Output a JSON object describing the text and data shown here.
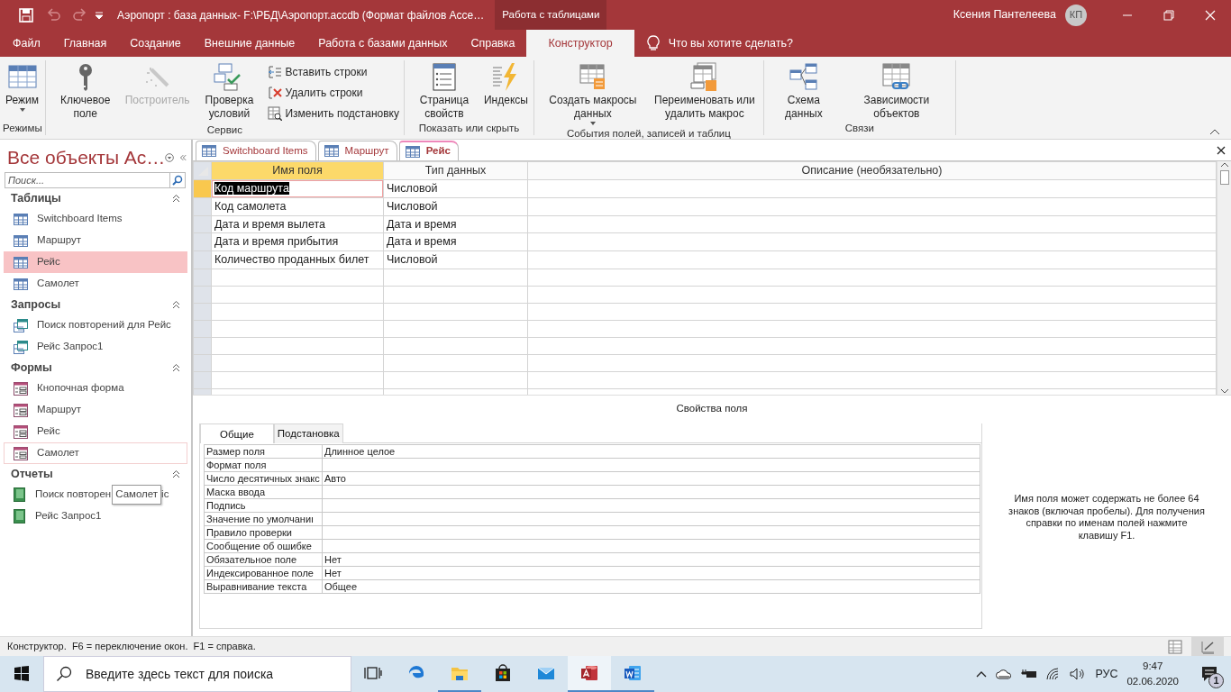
{
  "window": {
    "title": "Аэропорт : база данных- F:\\РБД\\Аэропорт.accdb (Формат файлов Acce…",
    "context_tab": "Работа с таблицами",
    "user": "Ксения Пантелеева",
    "avatar": "КП"
  },
  "quick_access": [
    {
      "disabled": false
    },
    {
      "disabled": true
    },
    {
      "disabled": true
    }
  ],
  "ribbon_tabs": [
    {
      "label": "Файл",
      "selected": false
    },
    {
      "label": "Главная",
      "selected": false
    },
    {
      "label": "Создание",
      "selected": false
    },
    {
      "label": "Внешние данные",
      "selected": false
    },
    {
      "label": "Работа с базами данных",
      "selected": false
    },
    {
      "label": "Справка",
      "selected": false
    },
    {
      "label": "Конструктор",
      "selected": true
    }
  ],
  "tell_me": "Что вы хотите сделать?",
  "ribbon_groups": [
    {
      "label": "Режимы",
      "buttons": [
        {
          "kind": "large",
          "label": "Режим",
          "dropdown": true,
          "disabled": false
        }
      ]
    },
    {
      "label": "Сервис",
      "buttons": [
        {
          "kind": "large",
          "label": "Ключевое поле",
          "dropdown": false,
          "disabled": false
        },
        {
          "kind": "large",
          "label": "Построитель",
          "dropdown": false,
          "disabled": true
        },
        {
          "kind": "large",
          "label": "Проверка условий",
          "dropdown": false,
          "disabled": false
        },
        {
          "kind": "small",
          "label": "Вставить строки",
          "disabled": false
        },
        {
          "kind": "small",
          "label": "Удалить строки",
          "disabled": false
        },
        {
          "kind": "small",
          "label": "Изменить подстановку",
          "disabled": false
        }
      ]
    },
    {
      "label": "Показать или скрыть",
      "buttons": [
        {
          "kind": "large",
          "label": "Страница свойств",
          "dropdown": false,
          "disabled": false
        },
        {
          "kind": "large",
          "label": "Индексы",
          "dropdown": false,
          "disabled": false
        }
      ]
    },
    {
      "label": "События полей, записей и таблиц",
      "buttons": [
        {
          "kind": "large",
          "label": "Создать макросы данных",
          "dropdown": true,
          "disabled": false
        },
        {
          "kind": "large",
          "label": "Переименовать или удалить макрос",
          "dropdown": false,
          "disabled": false
        }
      ]
    },
    {
      "label": "Связи",
      "buttons": [
        {
          "kind": "large",
          "label": "Схема данных",
          "dropdown": false,
          "disabled": false
        },
        {
          "kind": "large",
          "label": "Зависимости объектов",
          "dropdown": false,
          "disabled": false
        }
      ]
    }
  ],
  "nav": {
    "title": "Все объекты Ac…",
    "search_placeholder": "Поиск...",
    "groups": [
      {
        "label": "Таблицы",
        "kind": "table",
        "items": [
          {
            "label": "Switchboard Items",
            "selected": false,
            "hovered": false
          },
          {
            "label": "Маршрут",
            "selected": false,
            "hovered": false
          },
          {
            "label": "Рейс",
            "selected": true,
            "hovered": false
          },
          {
            "label": "Самолет",
            "selected": false,
            "hovered": false
          }
        ]
      },
      {
        "label": "Запросы",
        "kind": "query",
        "items": [
          {
            "label": "Поиск повторений для Рейс",
            "selected": false,
            "hovered": false
          },
          {
            "label": "Рейс Запрос1",
            "selected": false,
            "hovered": false
          }
        ]
      },
      {
        "label": "Формы",
        "kind": "form",
        "items": [
          {
            "label": "Кнопочная форма",
            "selected": false,
            "hovered": false
          },
          {
            "label": "Маршрут",
            "selected": false,
            "hovered": false
          },
          {
            "label": "Рейс",
            "selected": false,
            "hovered": false
          },
          {
            "label": "Самолет",
            "selected": false,
            "hovered": true
          }
        ]
      },
      {
        "label": "Отчеты",
        "kind": "report",
        "items": [
          {
            "label": "Поиск повторен",
            "label_tail": "іс",
            "tooltip": "Самолет",
            "selected": false,
            "hovered": false
          },
          {
            "label": "Рейс Запрос1",
            "selected": false,
            "hovered": false
          }
        ]
      }
    ]
  },
  "doc_tabs": [
    {
      "label": "Switchboard Items",
      "selected": false
    },
    {
      "label": "Маршрут",
      "selected": false
    },
    {
      "label": "Рейс",
      "selected": true
    }
  ],
  "design_grid": {
    "columns": [
      "Имя поля",
      "Тип данных",
      "Описание (необязательно)"
    ],
    "rows": [
      {
        "name": "Код маршрута",
        "type": "Числовой",
        "selected": true
      },
      {
        "name": "Код самолета",
        "type": "Числовой",
        "selected": false
      },
      {
        "name": "Дата и время вылета",
        "type": "Дата и время",
        "selected": false
      },
      {
        "name": "Дата и время прибытия",
        "type": "Дата и время",
        "selected": false
      },
      {
        "name": "Количество проданных билет",
        "type": "Числовой",
        "selected": false
      }
    ]
  },
  "field_properties": {
    "title": "Свойства поля",
    "tabs": [
      {
        "label": "Общие",
        "selected": true
      },
      {
        "label": "Подстановка",
        "selected": false
      }
    ],
    "rows": [
      {
        "name": "Размер поля",
        "value": "Длинное целое"
      },
      {
        "name": "Формат поля"
      },
      {
        "name": "Число десятичных знакс",
        "value": "Авто"
      },
      {
        "name": "Маска ввода"
      },
      {
        "name": "Подпись"
      },
      {
        "name": "Значение по умолчаниı"
      },
      {
        "name": "Правило проверки"
      },
      {
        "name": "Сообщение об ошибке"
      },
      {
        "name": "Обязательное поле",
        "value": "Нет"
      },
      {
        "name": "Индексированное поле",
        "value": "Нет"
      },
      {
        "name": "Выравнивание текста",
        "value": "Общее"
      }
    ],
    "help": "Имя поля может содержать не более 64 знаков (включая пробелы). Для получения справки по именам полей нажмите клавишу F1."
  },
  "status_bar": {
    "text": "Конструктор.  F6 = переключение окон.  F1 = справка.",
    "views": [
      {
        "selected": false
      },
      {
        "selected": true
      }
    ]
  },
  "taskbar": {
    "search_placeholder": "Введите здесь текст для поиска",
    "apps": [
      {
        "open": false,
        "active": false
      },
      {
        "open": false,
        "active": false
      },
      {
        "open": true,
        "active": false
      },
      {
        "open": false,
        "active": false
      },
      {
        "open": false,
        "active": false
      },
      {
        "open": true,
        "active": true
      },
      {
        "open": true,
        "active": false
      }
    ],
    "language": "РУС",
    "time": "9:47",
    "date": "02.06.2020",
    "notifications": "1"
  }
}
